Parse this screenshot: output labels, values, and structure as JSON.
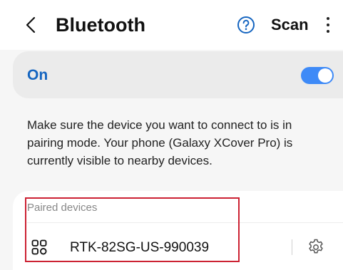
{
  "header": {
    "title": "Bluetooth",
    "scan_label": "Scan"
  },
  "bluetooth_toggle": {
    "state_label": "On",
    "enabled": true
  },
  "description": "Make sure the device you want to connect to is in pairing mode. Your phone (Galaxy XCover Pro) is currently visible to nearby devices.",
  "paired_devices": {
    "section_label": "Paired devices",
    "items": [
      {
        "name": "RTK-82SG-US-990039",
        "icon": "device-grid-icon"
      }
    ]
  },
  "colors": {
    "accent": "#1565c0",
    "toggle_on": "#3e8af7",
    "highlight": "#cc2233"
  }
}
